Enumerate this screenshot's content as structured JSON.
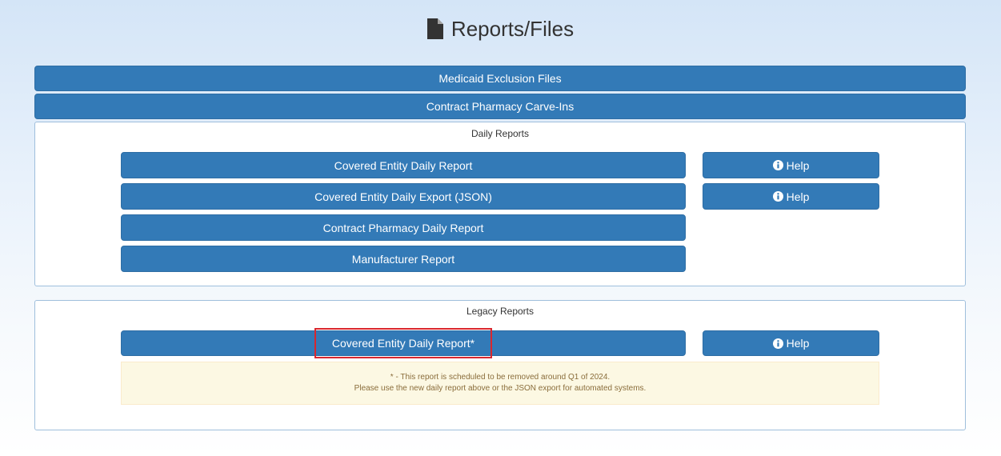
{
  "page": {
    "title": "Reports/Files"
  },
  "top_buttons": {
    "medicaid": "Medicaid Exclusion Files",
    "carve_ins": "Contract Pharmacy Carve-Ins"
  },
  "daily_reports": {
    "title": "Daily Reports",
    "covered_entity_report": "Covered Entity Daily Report",
    "covered_entity_export": "Covered Entity Daily Export (JSON)",
    "contract_pharmacy_report": "Contract Pharmacy Daily Report",
    "manufacturer_report": "Manufacturer Report",
    "help_label": "Help"
  },
  "legacy_reports": {
    "title": "Legacy Reports",
    "covered_entity_report": "Covered Entity Daily Report*",
    "help_label": "Help",
    "notice_line1": "* - This report is scheduled to be removed around Q1 of 2024.",
    "notice_line2": "Please use the new daily report above or the JSON export for automated systems."
  },
  "colors": {
    "primary_button": "#337ab7",
    "highlight_border": "#d9272e",
    "notice_background": "#fcf8e3",
    "notice_text": "#8a6d3b"
  },
  "icons": {
    "title_icon": "file-icon",
    "help_icon": "info-circle-icon"
  }
}
